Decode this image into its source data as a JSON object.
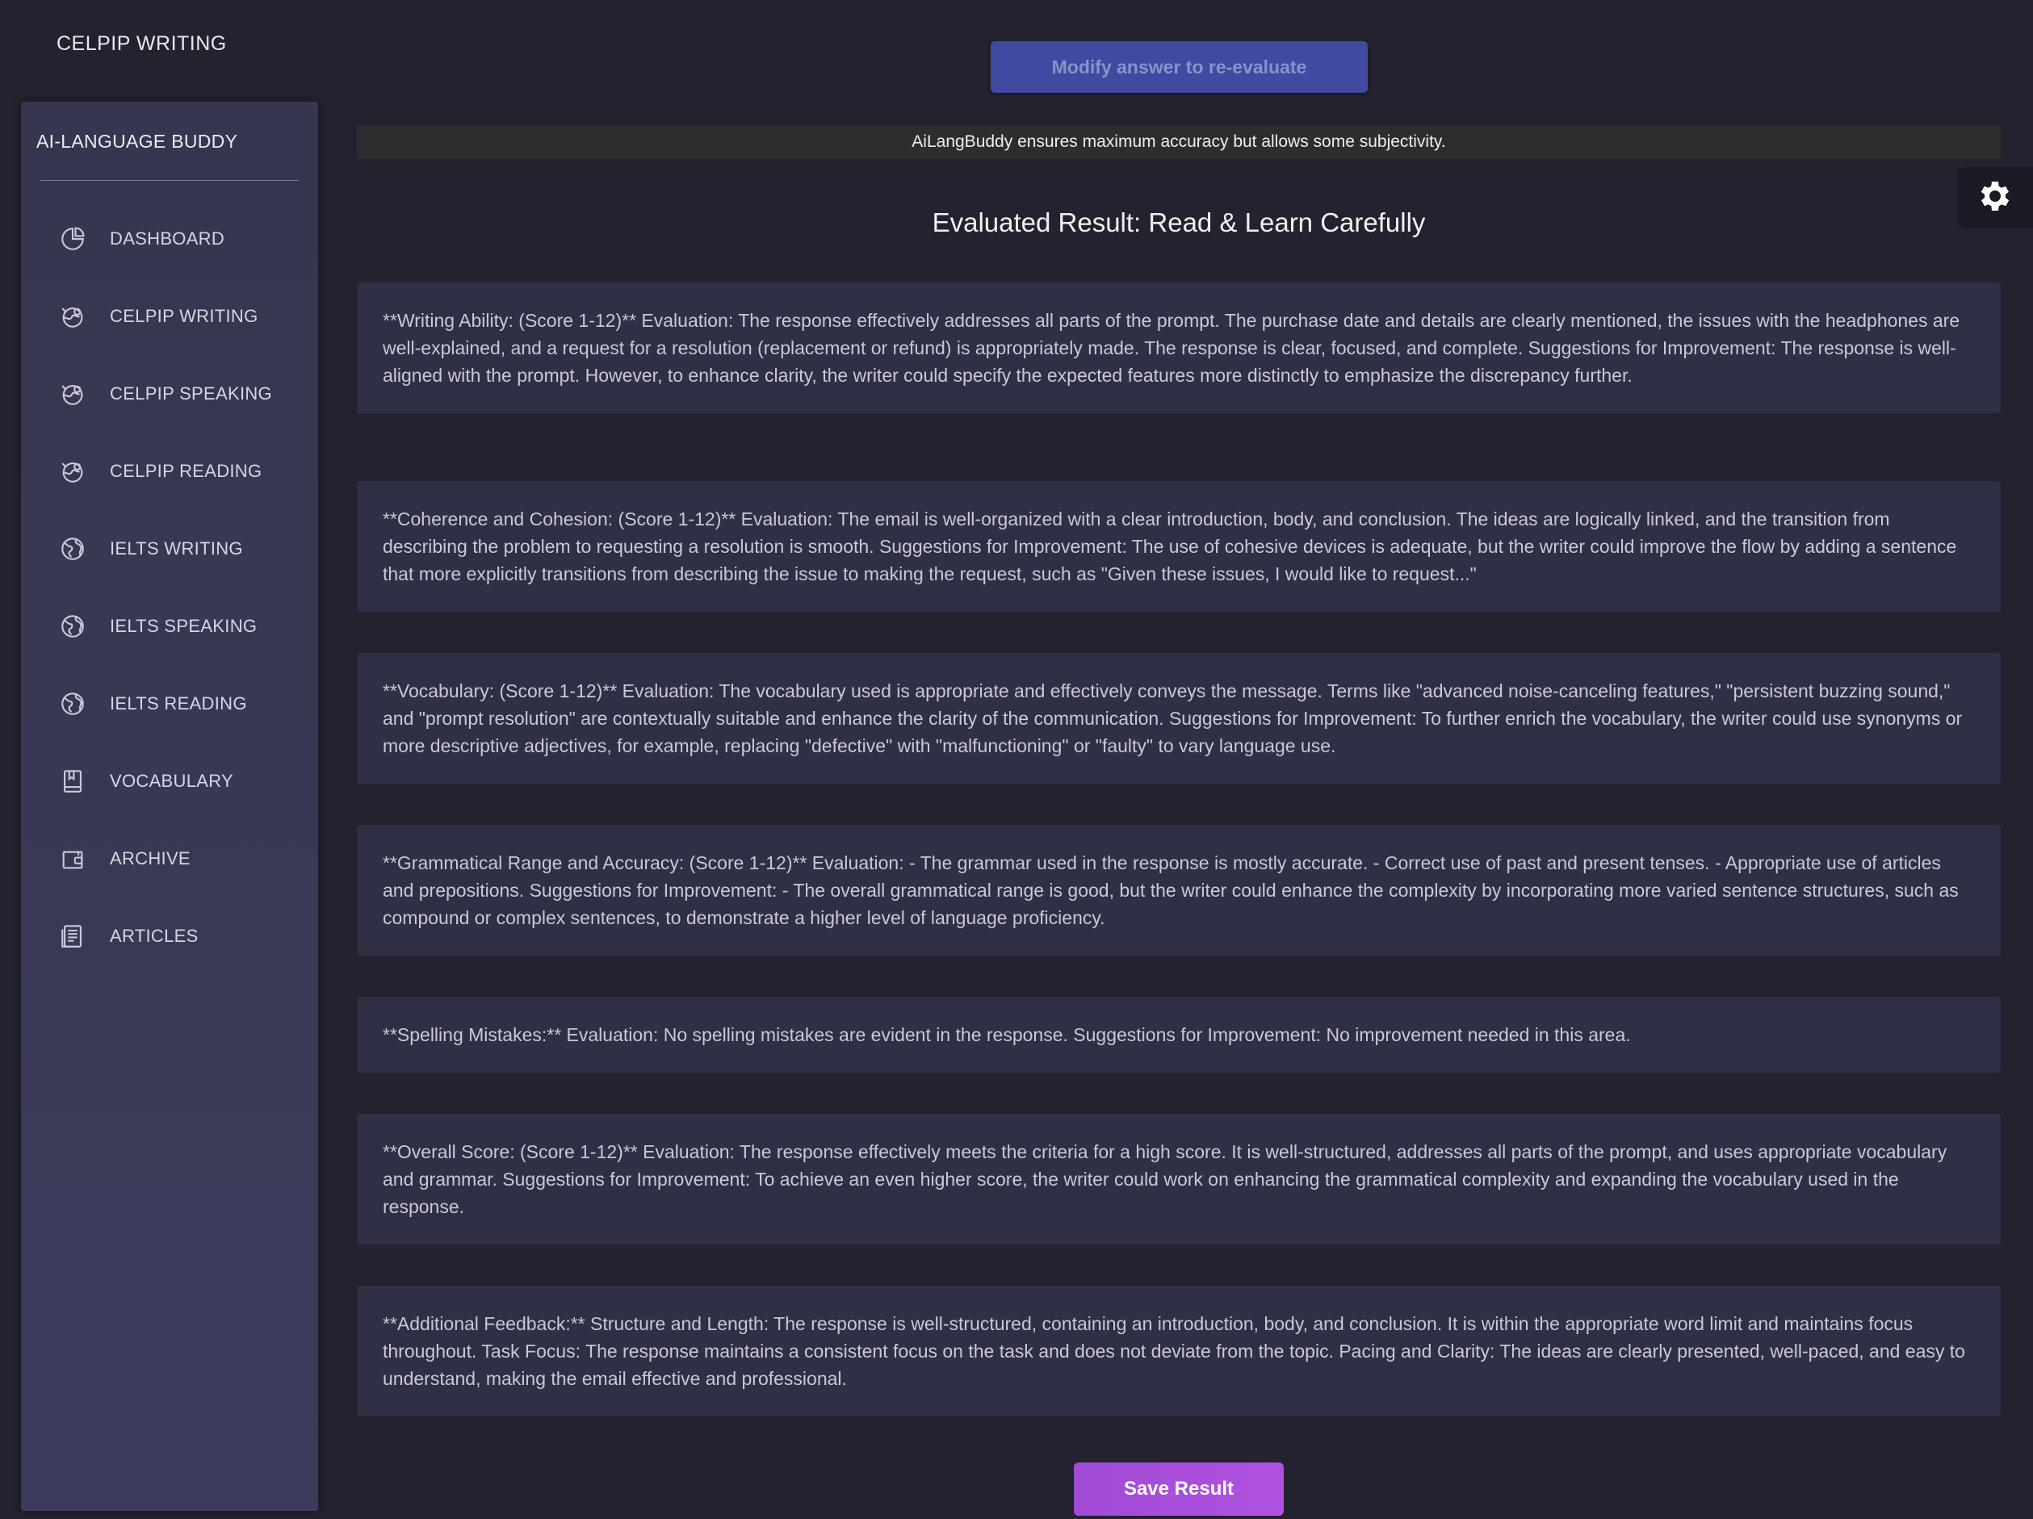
{
  "header": {
    "app_title": "CELPIP WRITING"
  },
  "sidebar": {
    "brand": "AI-LANGUAGE BUDDY",
    "items": [
      {
        "label": "DASHBOARD",
        "icon": "pie-chart-icon"
      },
      {
        "label": "CELPIP WRITING",
        "icon": "globe-pin-icon"
      },
      {
        "label": "CELPIP SPEAKING",
        "icon": "globe-pin-icon"
      },
      {
        "label": "CELPIP READING",
        "icon": "globe-pin-icon"
      },
      {
        "label": "IELTS WRITING",
        "icon": "globe-icon"
      },
      {
        "label": "IELTS SPEAKING",
        "icon": "globe-icon"
      },
      {
        "label": "IELTS READING",
        "icon": "globe-icon"
      },
      {
        "label": "VOCABULARY",
        "icon": "book-icon"
      },
      {
        "label": "ARCHIVE",
        "icon": "wallet-icon"
      },
      {
        "label": "ARTICLES",
        "icon": "document-icon"
      }
    ]
  },
  "main": {
    "modify_button": "Modify answer to re-evaluate",
    "disclaimer": "AiLangBuddy ensures maximum accuracy but allows some subjectivity.",
    "title": "Evaluated Result: Read & Learn Carefully",
    "sections": [
      "**Writing Ability: (Score 1-12)** Evaluation: The response effectively addresses all parts of the prompt. The purchase date and details are clearly mentioned, the issues with the headphones are well-explained, and a request for a resolution (replacement or refund) is appropriately made. The response is clear, focused, and complete. Suggestions for Improvement: The response is well-aligned with the prompt. However, to enhance clarity, the writer could specify the expected features more distinctly to emphasize the discrepancy further.",
      "**Coherence and Cohesion: (Score 1-12)** Evaluation: The email is well-organized with a clear introduction, body, and conclusion. The ideas are logically linked, and the transition from describing the problem to requesting a resolution is smooth. Suggestions for Improvement: The use of cohesive devices is adequate, but the writer could improve the flow by adding a sentence that more explicitly transitions from describing the issue to making the request, such as \"Given these issues, I would like to request...\"",
      "**Vocabulary: (Score 1-12)** Evaluation: The vocabulary used is appropriate and effectively conveys the message. Terms like \"advanced noise-canceling features,\" \"persistent buzzing sound,\" and \"prompt resolution\" are contextually suitable and enhance the clarity of the communication. Suggestions for Improvement: To further enrich the vocabulary, the writer could use synonyms or more descriptive adjectives, for example, replacing \"defective\" with \"malfunctioning\" or \"faulty\" to vary language use.",
      "**Grammatical Range and Accuracy: (Score 1-12)** Evaluation: - The grammar used in the response is mostly accurate. - Correct use of past and present tenses. - Appropriate use of articles and prepositions. Suggestions for Improvement: - The overall grammatical range is good, but the writer could enhance the complexity by incorporating more varied sentence structures, such as compound or complex sentences, to demonstrate a higher level of language proficiency.",
      "**Spelling Mistakes:** Evaluation: No spelling mistakes are evident in the response. Suggestions for Improvement: No improvement needed in this area.",
      "**Overall Score: (Score 1-12)** Evaluation: The response effectively meets the criteria for a high score. It is well-structured, addresses all parts of the prompt, and uses appropriate vocabulary and grammar. Suggestions for Improvement: To achieve an even higher score, the writer could work on enhancing the grammatical complexity and expanding the vocabulary used in the response.",
      "**Additional Feedback:** Structure and Length: The response is well-structured, containing an introduction, body, and conclusion. It is within the appropriate word limit and maintains focus throughout. Task Focus: The response maintains a consistent focus on the task and does not deviate from the topic. Pacing and Clarity: The ideas are clearly presented, well-paced, and easy to understand, making the email effective and professional."
    ],
    "save_button": "Save Result"
  },
  "colors": {
    "accent_blue": "#3f4aa0",
    "accent_purple": "#a04ad6",
    "sidebar": "#383855",
    "background": "#23222e"
  }
}
